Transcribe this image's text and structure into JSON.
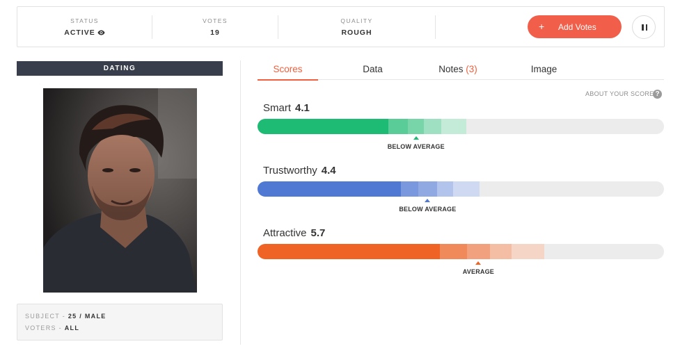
{
  "header": {
    "status": {
      "label": "STATUS",
      "value": "ACTIVE",
      "icon": "eye-icon"
    },
    "votes": {
      "label": "VOTES",
      "value": "19"
    },
    "quality": {
      "label": "QUALITY",
      "value": "ROUGH"
    },
    "add_votes": {
      "plus": "+",
      "label": "Add Votes"
    },
    "pause_icon": "pause-icon"
  },
  "left": {
    "category": "DATING",
    "subject": {
      "key": "SUBJECT",
      "sep": " - ",
      "value": "25 / MALE"
    },
    "voters": {
      "key": "VOTERS",
      "sep": " - ",
      "value": "ALL"
    }
  },
  "tabs": [
    {
      "label": "Scores"
    },
    {
      "label": "Data"
    },
    {
      "label": "Notes",
      "count": "(3)"
    },
    {
      "label": "Image"
    }
  ],
  "about_scores": "ABOUT YOUR SCORES",
  "help_icon": "?",
  "scores": [
    {
      "name": "Smart",
      "value": "4.1",
      "verdict": "BELOW AVERAGE",
      "score": 4.1,
      "colors": [
        "#1ebb74",
        "#5acc98",
        "#78d5aa",
        "#9fe0c2",
        "#c4ebd8"
      ]
    },
    {
      "name": "Trustworthy",
      "value": "4.4",
      "verdict": "BELOW AVERAGE",
      "score": 4.4,
      "colors": [
        "#5079d4",
        "#7a98de",
        "#91a9e3",
        "#b2c3ec",
        "#cfd9f2"
      ]
    },
    {
      "name": "Attractive",
      "value": "5.7",
      "verdict": "AVERAGE",
      "score": 5.7,
      "colors": [
        "#ef6425",
        "#f08a5b",
        "#f2a17e",
        "#f4bea4",
        "#f5d6c6"
      ]
    }
  ]
}
